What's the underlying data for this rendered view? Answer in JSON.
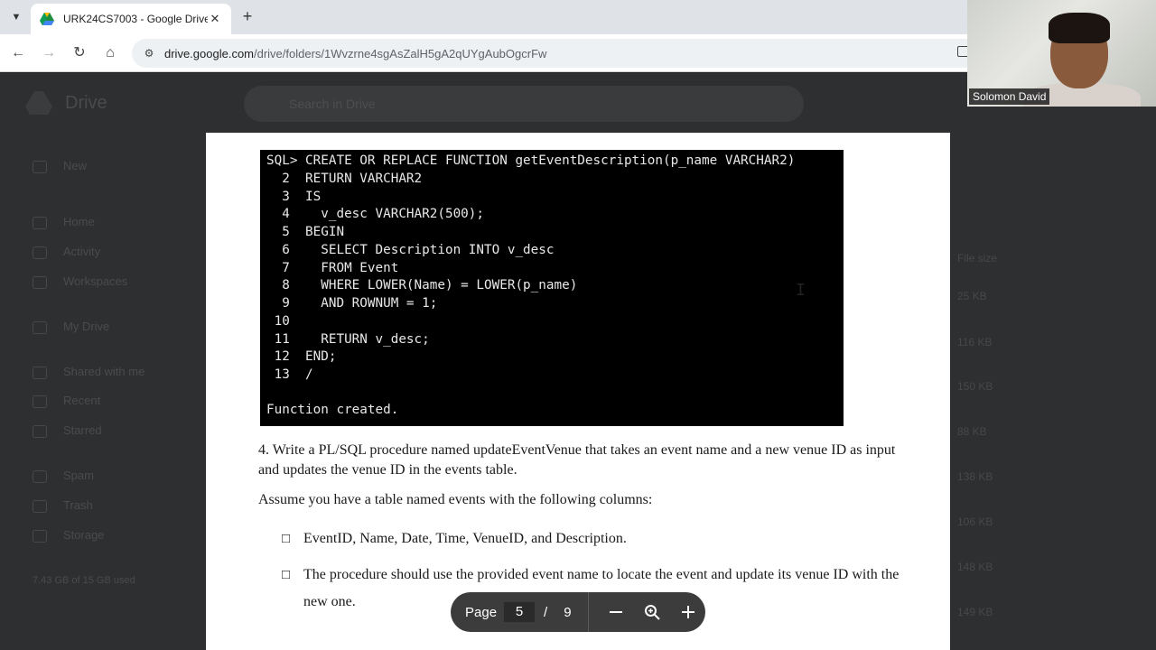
{
  "browser": {
    "tab_title": "URK24CS7003 - Google Drive",
    "url_domain": "drive.google.com",
    "url_path": "/drive/folders/1Wvzrne4sgAsZalH5gA2qUYgAubOgcrFw"
  },
  "drive": {
    "app_name": "Drive",
    "search_placeholder": "Search in Drive",
    "sidebar": [
      "New",
      "Home",
      "Activity",
      "Workspaces",
      "My Drive",
      "Shared with me",
      "Recent",
      "Starred",
      "Spam",
      "Trash",
      "Storage"
    ],
    "storage_text": "7.43 GB of 15 GB used",
    "column_header": "File size",
    "file_sizes": [
      "25 KB",
      "116 KB",
      "150 KB",
      "88 KB",
      "138 KB",
      "106 KB",
      "148 KB",
      "149 KB"
    ]
  },
  "webcam": {
    "participant_name": "Solomon David"
  },
  "document": {
    "code_lines": [
      "SQL> CREATE OR REPLACE FUNCTION getEventDescription(p_name VARCHAR2)",
      "  2  RETURN VARCHAR2",
      "  3  IS",
      "  4    v_desc VARCHAR2(500);",
      "  5  BEGIN",
      "  6    SELECT Description INTO v_desc",
      "  7    FROM Event",
      "  8    WHERE LOWER(Name) = LOWER(p_name)",
      "  9    AND ROWNUM = 1;",
      " 10",
      " 11    RETURN v_desc;",
      " 12  END;",
      " 13  /"
    ],
    "code_result": "Function created.",
    "question_text": "4. Write a PL/SQL procedure named updateEventVenue that takes an event name and a new venue ID as input and updates the venue ID in the events table.",
    "assume_text": "Assume you have a table named events with the following columns:",
    "bullets": [
      "EventID, Name, Date, Time, VenueID, and Description.",
      "The procedure should use the provided event name to locate the event and update its venue ID with the new one."
    ],
    "bullet_glyph": ""
  },
  "pager": {
    "label": "Page",
    "current": "5",
    "separator": "/",
    "total": "9",
    "zoom_out_icon": "minus-icon",
    "zoom_icon": "magnifier-icon",
    "zoom_in_icon": "plus-icon"
  }
}
